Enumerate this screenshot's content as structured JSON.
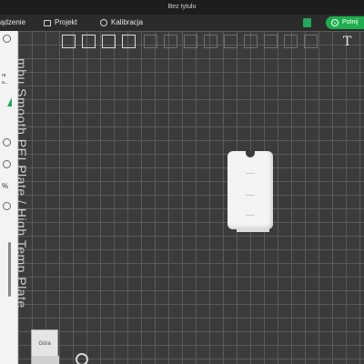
{
  "window": {
    "title": "Bez tytułu"
  },
  "menu": {
    "device_label": "ądzenie",
    "project_label": "Projekt",
    "calibration_label": "Kalibracja"
  },
  "slice_button": {
    "label": "Potnij"
  },
  "left_panel": {
    "partial_text_1": "ra",
    "partial_text_2": "a...",
    "percent_label": "%"
  },
  "viewport": {
    "plate_label": "mbu Smooth PEI Plate / High Temp Plate"
  },
  "view_cube": {
    "label": "Góra"
  },
  "colors": {
    "accent": "#1fae4f",
    "background": "#3b3b3b",
    "model": "#f4f4f4"
  },
  "icons": [
    "project-icon",
    "calibration-icon",
    "cube-icon",
    "grid-icon",
    "auto-orient-icon",
    "layout-icon",
    "text-tool-icon",
    "camera-icon"
  ]
}
